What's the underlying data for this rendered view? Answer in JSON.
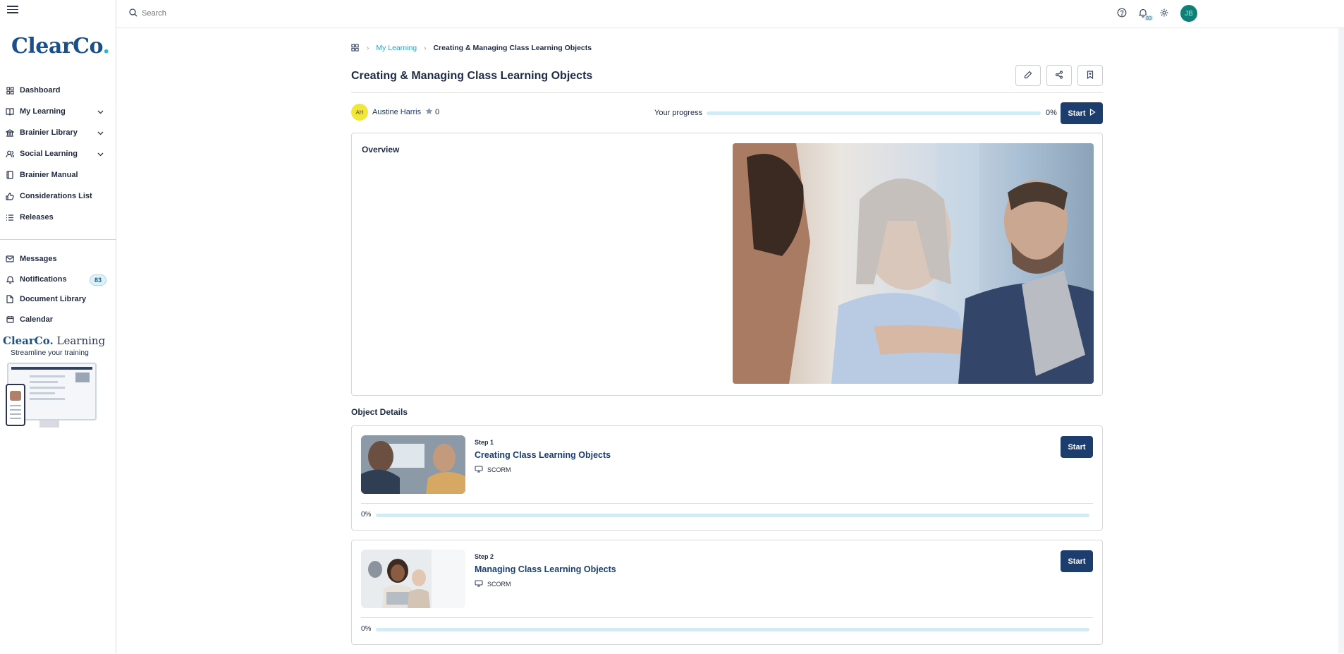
{
  "sidebar": {
    "logo_text": "ClearCo",
    "logo_dot": ".",
    "nav_items": [
      {
        "label": "Dashboard",
        "icon": "grid-icon",
        "has_chevron": false
      },
      {
        "label": "My Learning",
        "icon": "book-icon",
        "has_chevron": true
      },
      {
        "label": "Brainier Library",
        "icon": "bank-icon",
        "has_chevron": true
      },
      {
        "label": "Social Learning",
        "icon": "users-icon",
        "has_chevron": true
      },
      {
        "label": "Brainier Manual",
        "icon": "manual-icon",
        "has_chevron": false
      },
      {
        "label": "Considerations List",
        "icon": "thumb-icon",
        "has_chevron": false
      },
      {
        "label": "Releases",
        "icon": "list-icon",
        "has_chevron": false
      }
    ],
    "secondary_items": [
      {
        "label": "Messages",
        "icon": "mail-icon"
      },
      {
        "label": "Notifications",
        "icon": "bell-icon",
        "badge": "83"
      },
      {
        "label": "Document Library",
        "icon": "document-icon"
      },
      {
        "label": "Calendar",
        "icon": "calendar-icon"
      }
    ],
    "promo": {
      "brand": "ClearCo.",
      "brand_suffix": "Learning",
      "tagline": "Streamline your training"
    }
  },
  "topbar": {
    "search_placeholder": "Search",
    "notification_count": "83",
    "user_initials": "JB"
  },
  "breadcrumb": {
    "parent": "My Learning",
    "current": "Creating & Managing Class Learning Objects"
  },
  "page": {
    "title": "Creating & Managing Class Learning Objects",
    "author_initials": "AH",
    "author_name": "Austine Harris",
    "rating": "0",
    "progress_label": "Your progress",
    "progress_value": 0,
    "progress_text": "0%",
    "start_label": "Start"
  },
  "overview": {
    "title": "Overview"
  },
  "object_details": {
    "title": "Object Details",
    "steps": [
      {
        "label": "Step 1",
        "name": "Creating Class Learning Objects",
        "type": "SCORM",
        "start_label": "Start",
        "progress_text": "0%",
        "progress_value": 0
      },
      {
        "label": "Step 2",
        "name": "Managing Class Learning Objects",
        "type": "SCORM",
        "start_label": "Start",
        "progress_text": "0%",
        "progress_value": 0
      }
    ]
  },
  "colors": {
    "primary": "#1c3d6e",
    "accent": "#2a9fd6",
    "avatar_user": "#0f7f78",
    "avatar_author": "#f2e63a"
  }
}
